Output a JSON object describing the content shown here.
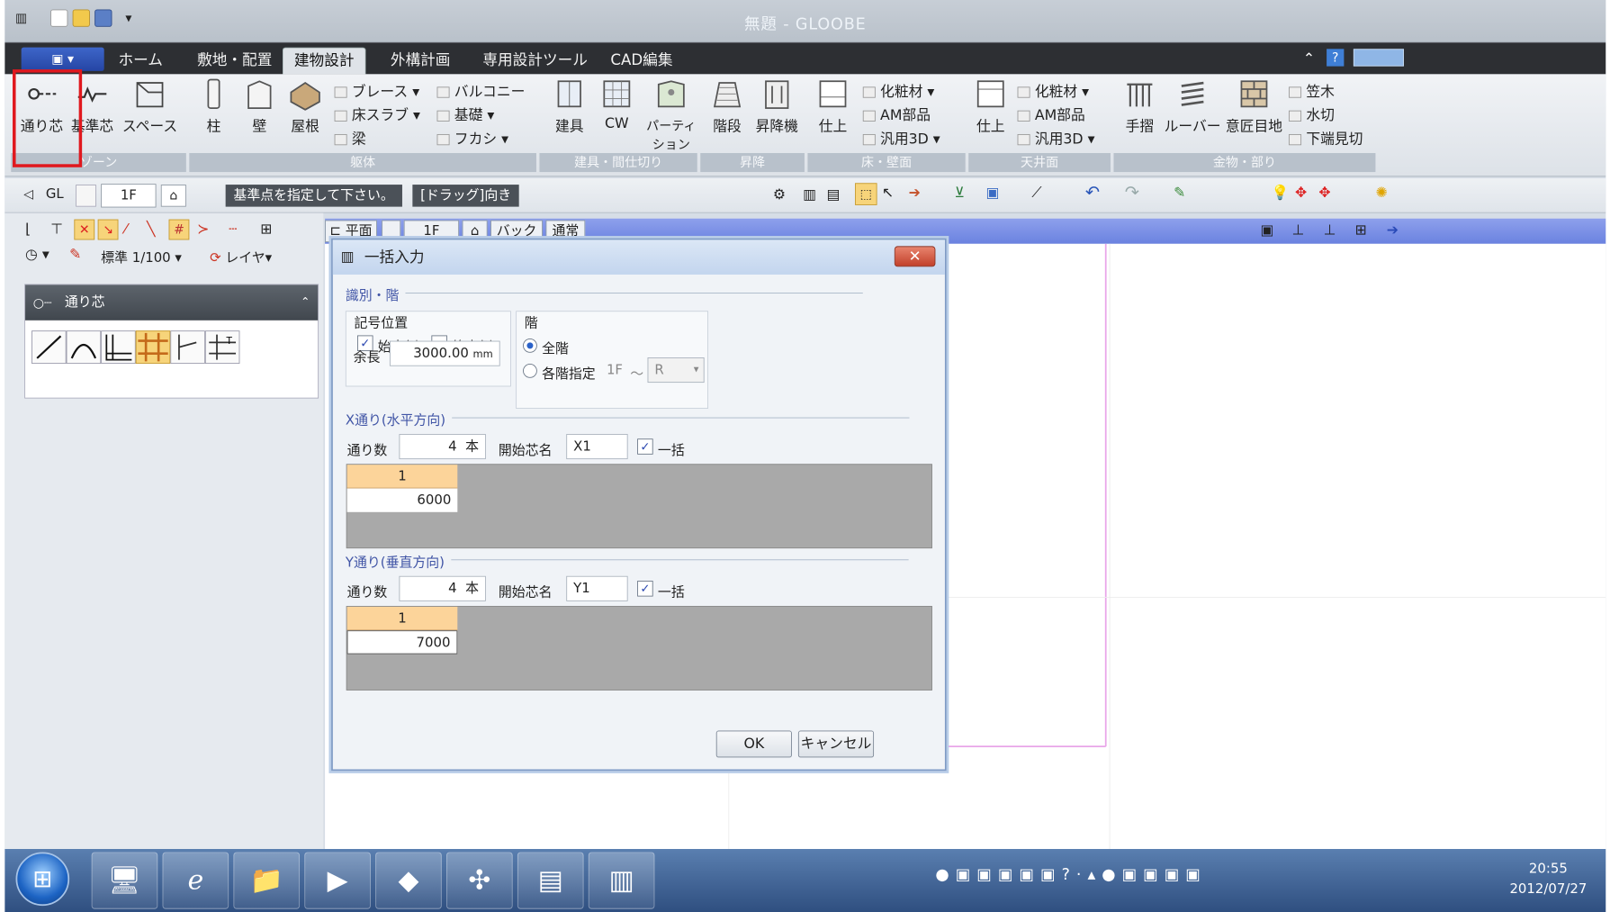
{
  "window": {
    "title": "無題 - GLOOBE"
  },
  "menu": {
    "app_button": "",
    "tabs": [
      "ホーム",
      "敷地・配置",
      "建物設計",
      "外構計画",
      "専用設計ツール",
      "CAD編集"
    ],
    "active_tab": "建物設計"
  },
  "ribbon": {
    "zone": {
      "items": [
        "通り芯",
        "基準芯",
        "スペース"
      ],
      "group": "ゾーン"
    },
    "frame": {
      "items": [
        "柱",
        "壁",
        "屋根"
      ],
      "small": [
        "ブレース",
        "床スラブ",
        "梁"
      ],
      "small2": [
        "バルコニー",
        "基礎",
        "フカシ"
      ],
      "group": "躯体"
    },
    "fitting": {
      "items": [
        "建具",
        "CW",
        "パーティション"
      ],
      "group": "建具・間仕切り"
    },
    "stairs": {
      "items": [
        "階段",
        "昇降機"
      ],
      "group": "昇降"
    },
    "floorwall": {
      "items": [
        "仕上"
      ],
      "small": [
        "化粧材",
        "AM部品",
        "汎用3D"
      ],
      "group": "床・壁面"
    },
    "ceiling": {
      "items": [
        "仕上"
      ],
      "small": [
        "化粧材",
        "AM部品",
        "汎用3D"
      ],
      "group": "天井面"
    },
    "hardware": {
      "items": [
        "手摺",
        "ルーバー",
        "意匠目地"
      ],
      "small": [
        "笠木",
        "水切",
        "下端見切"
      ],
      "group": "金物・部り"
    }
  },
  "toolbar2": {
    "gl_label": "GL",
    "floor": "1F",
    "status_message": "基準点を指定して下さい。",
    "drag_hint": "[ドラッグ]向き"
  },
  "left_panel": {
    "scale": "標準 1/100",
    "layer": "レイヤ",
    "panel_title": "通り芯"
  },
  "canvas_bar": {
    "view": "平面",
    "floor": "1F",
    "back": "バック",
    "mode": "通常"
  },
  "dialog": {
    "title": "一括入力",
    "section_kind": "識別・階",
    "symbol_position_label": "記号位置",
    "start_side": {
      "label": "始点側",
      "checked": true
    },
    "end_side": {
      "label": "終点側",
      "checked": false
    },
    "margin_label": "余長",
    "margin_value": "3000.00",
    "margin_unit": "mm",
    "floor_label": "階",
    "all_floors": {
      "label": "全階",
      "selected": true
    },
    "each_floor": {
      "label": "各階指定",
      "selected": false,
      "from": "1F",
      "tilde": "〜",
      "to": "R"
    },
    "x_section": "X通り(水平方向)",
    "x_count_label": "通り数",
    "x_count": "4",
    "x_count_unit": "本",
    "x_start_label": "開始芯名",
    "x_start_name": "X1",
    "x_bulk": {
      "label": "一括",
      "checked": true
    },
    "x_grid": {
      "header": "1",
      "value": "6000"
    },
    "y_section": "Y通り(垂直方向)",
    "y_count_label": "通り数",
    "y_count": "4",
    "y_count_unit": "本",
    "y_start_label": "開始芯名",
    "y_start_name": "Y1",
    "y_bulk": {
      "label": "一括",
      "checked": true
    },
    "y_grid": {
      "header": "1",
      "value": "7000"
    },
    "ok": "OK",
    "cancel": "キャンセル"
  },
  "taskbar": {
    "time": "20:55",
    "date": "2012/07/27"
  },
  "colors": {
    "highlight": "#e0181e",
    "canvas_bar": "#7a8fe6",
    "grid_header": "#fcd49a"
  }
}
